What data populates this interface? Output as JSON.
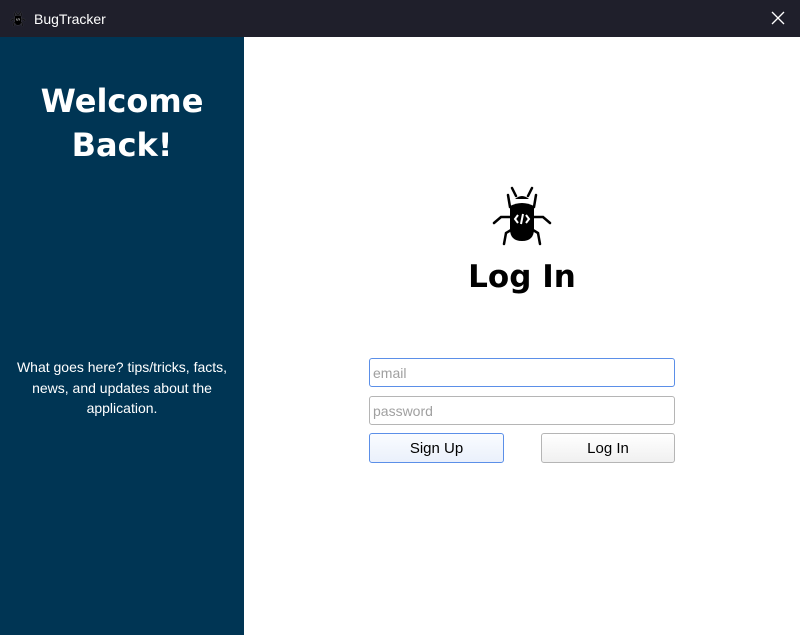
{
  "window": {
    "title": "BugTracker",
    "app_icon": "bug-icon",
    "close_icon": "close-icon"
  },
  "sidebar": {
    "heading": "Welcome Back!",
    "blurb": "What goes here? tips/tricks, facts, news, and updates about the application.",
    "background": "#003554"
  },
  "main": {
    "logo_icon": "bug-code-icon",
    "heading": "Log In",
    "email": {
      "placeholder": "email",
      "value": ""
    },
    "password": {
      "placeholder": "password",
      "value": ""
    },
    "signup_label": "Sign Up",
    "login_label": "Log In",
    "focus_color": "#5b8fe8"
  }
}
